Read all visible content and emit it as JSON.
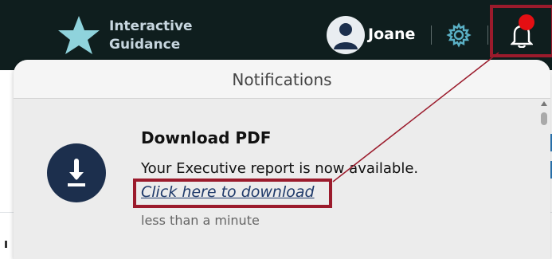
{
  "brand": {
    "line1": "Interactive",
    "line2": "Guidance"
  },
  "user": {
    "name": "Joane"
  },
  "icons": {
    "logo": "star-icon",
    "avatar": "user-avatar-icon",
    "settings": "gear-icon",
    "notifications": "bell-icon",
    "notification_type": "download-icon"
  },
  "colors": {
    "topbar": "#0f1e1e",
    "highlight": "#9b1b2c",
    "badge": "#e40f13",
    "notif_icon_bg": "#1c2f4d"
  },
  "notifications_panel": {
    "title": "Notifications",
    "items": [
      {
        "title": "Download PDF",
        "message": "Your Executive report is now available.",
        "link_text": "Click here to download",
        "time": "less than a minute"
      }
    ]
  }
}
